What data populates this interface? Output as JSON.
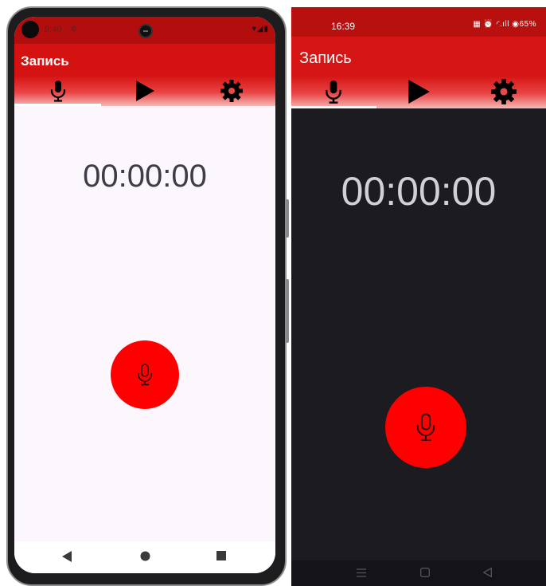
{
  "left_phone": {
    "status_bar": {
      "time": "9:40",
      "settings_icon": "gear-icon",
      "sys_icons": "▾◢▮"
    },
    "app_title": "Запись",
    "tabs": [
      {
        "icon": "microphone-icon",
        "active": true
      },
      {
        "icon": "play-icon",
        "active": false
      },
      {
        "icon": "gear-icon",
        "active": false
      }
    ],
    "timer": "00:00:00",
    "record_button_icon": "microphone-icon",
    "nav": {
      "back": "back-triangle-icon",
      "home": "home-circle-icon",
      "recents": "recents-square-icon"
    }
  },
  "right_phone": {
    "status_bar": {
      "time": "16:39",
      "sys_icons": "▦ ⏰ ◜.ıll ◉65%"
    },
    "app_title": "Запись",
    "tabs": [
      {
        "icon": "microphone-icon",
        "active": true
      },
      {
        "icon": "play-icon",
        "active": false
      },
      {
        "icon": "gear-icon",
        "active": false
      }
    ],
    "timer": "00:00:00",
    "record_button_icon": "microphone-icon",
    "nav": {
      "recents": "menu-lines-icon",
      "home": "home-square-icon",
      "back": "back-triangle-icon"
    }
  },
  "colors": {
    "appbar_red": "#d51212",
    "status_red": "#b20e0e",
    "record_button": "#ff0000",
    "light_background": "#fbf7fd",
    "dark_background": "#1c1b20"
  }
}
